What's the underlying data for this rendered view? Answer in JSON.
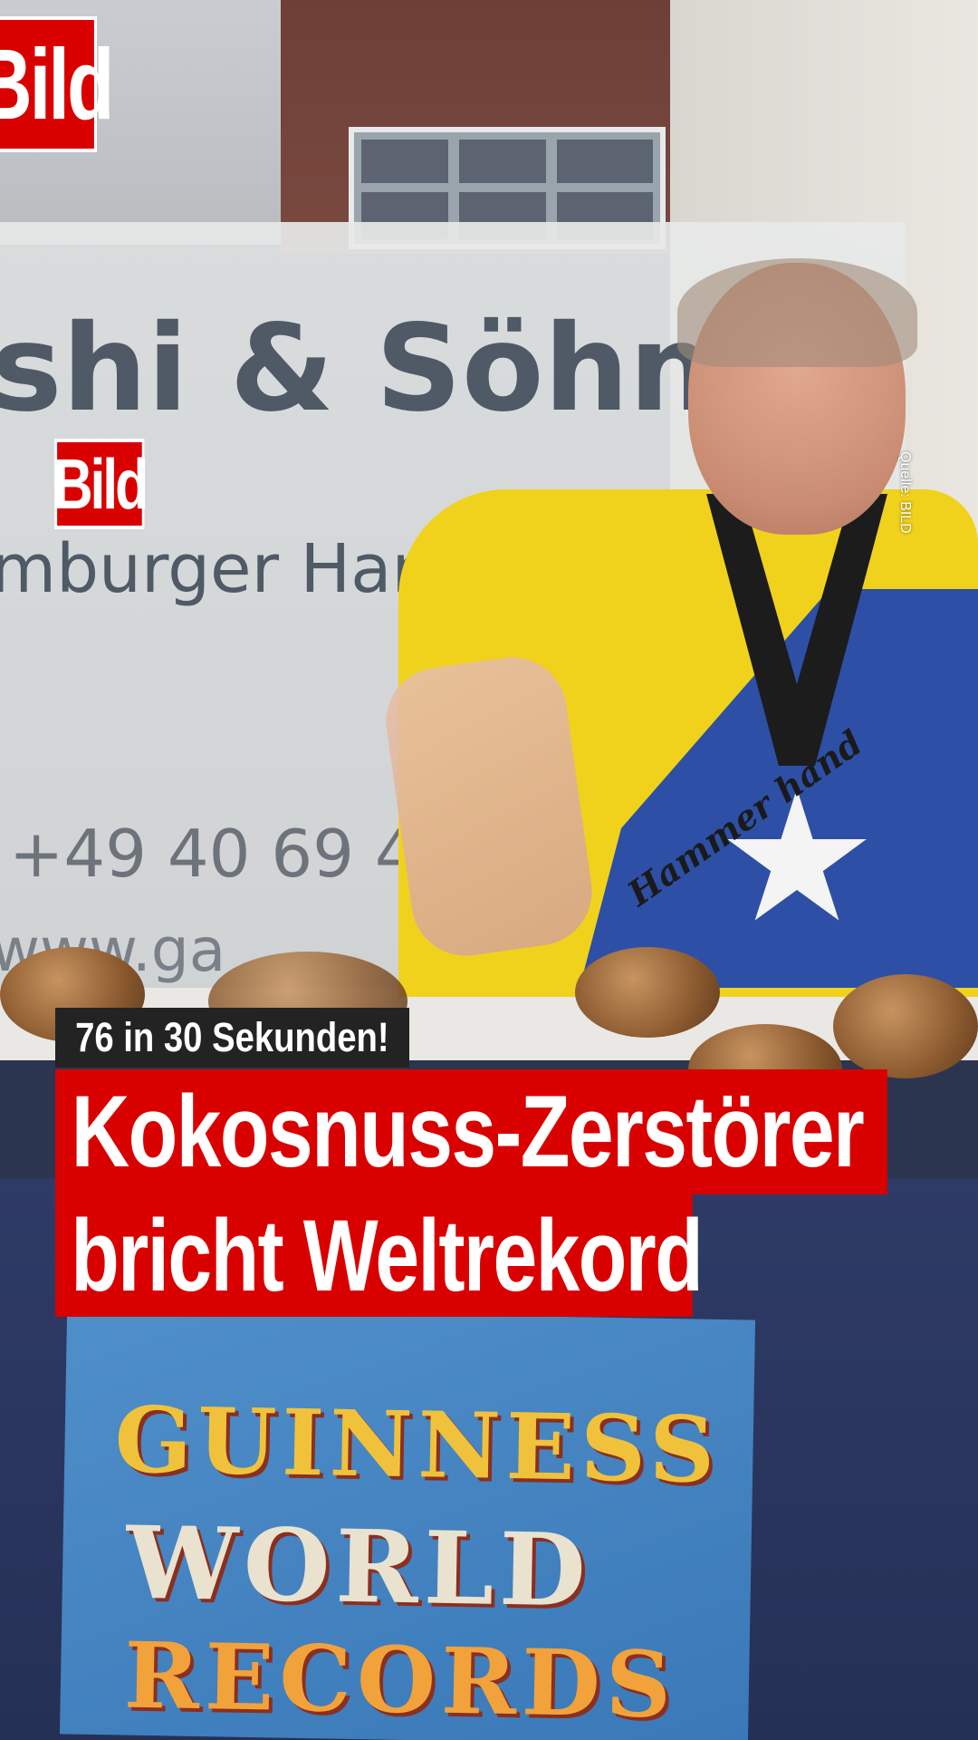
{
  "brand": {
    "logo_text": "Bild",
    "logo_color": "#d90000"
  },
  "source_credit": "Quelle: BILD",
  "kicker": "76 in 30 Sekunden!",
  "headline": {
    "line1": "Kokosnuss-Zerstörer",
    "line2": "bricht Weltrekord"
  },
  "background_text": {
    "sign_company": "shi & Söhn",
    "sign_subtitle": "mburger Hand",
    "sign_phone": "+49 40 69 4",
    "sign_web": "www.ga",
    "shirt_text": "Hammer hand",
    "poster_line1": "GUINNESS",
    "poster_line2": "WORLD",
    "poster_line3": "RECORDS"
  }
}
